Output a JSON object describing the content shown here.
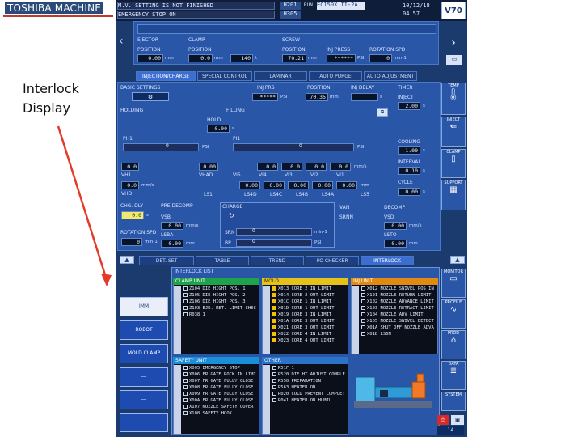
{
  "slide": {
    "brand": "TOSHIBA MACHINE",
    "caption_line1": "Interlock",
    "caption_line2": "Display"
  },
  "topbar": {
    "msg1": "M.V. SETTING IS NOT FINISHED",
    "msg2": "EMERGENCY STOP ON",
    "code1": "H201",
    "code2": "H305",
    "run": "RUN",
    "model": "EC150X II-2A",
    "date": "10/12/18",
    "time": "04:57",
    "logo": "V70"
  },
  "mold": {
    "headers": [
      "EJECTOR",
      "CLAMP",
      "SCREW"
    ],
    "fields": [
      {
        "label": "POSITION",
        "value": "0.00",
        "unit": "mm"
      },
      {
        "label": "POSITION",
        "value": "0.0",
        "unit": "mm"
      },
      {
        "label": "",
        "value": "140",
        "unit": "t"
      },
      {
        "label": "POSITION",
        "value": "70.21",
        "unit": "mm"
      },
      {
        "label": "INJ PRESS",
        "value": "******",
        "unit": "PSI"
      },
      {
        "label": "ROTATION SPD",
        "value": "0",
        "unit": "min-1"
      }
    ]
  },
  "tabs_upper": [
    "INJECTION/CHARGE",
    "SPECIAL CONTROL",
    "LAMINAR",
    "AUTO PURGE",
    "AUTO ADJUSTMENT"
  ],
  "injection": {
    "basic_settings": "BASIC SETTINGS",
    "inj_prs": "INJ PRS",
    "inj_prs_value": "*****",
    "inj_prs_unit": "PSI",
    "position": "POSITION",
    "position_value": "70.35",
    "position_unit": "mm",
    "inj_delay": "INJ DELAY",
    "inj_delay_unit": "s",
    "holding": "HOLDING",
    "filling": "FILLING",
    "hold": "HOLD",
    "hold_value": "0.00",
    "hold_unit": "s",
    "timer": "TIMER",
    "inject": "INJECT",
    "inject_value": "2.00",
    "inject_unit": "s",
    "cooling": "COOLING",
    "cooling_value": "1.00",
    "cooling_unit": "s",
    "interval": "INTERVAL",
    "interval_value": "0.10",
    "interval_unit": "s",
    "cycle": "CYCLE",
    "cycle_value": "0.00",
    "cycle_unit": "s",
    "ph": "PH1",
    "ph_value": "0",
    "ph_unit": "PSI",
    "pi": "PI1",
    "pi_value": "0",
    "pi_unit": "PSI",
    "vh_value": "0.0",
    "vhad": "VHAD",
    "vhad_value": "0.00",
    "vh1": "VH1",
    "vi_labels": [
      "VI5",
      "VI4",
      "VI3",
      "VI2",
      "VI1"
    ],
    "vi_values": [
      "0.0",
      "0.0",
      "0.0",
      "0.0"
    ],
    "vi_unit": "mm/s",
    "vhd": "VHD",
    "vhd_value": "0.0",
    "vhd_unit": "mm/s",
    "ls_labels": [
      "LS1",
      "LS4D",
      "LS4C",
      "LS4B",
      "LS4A",
      "LS5"
    ],
    "ls_values": [
      "0.00",
      "0.00",
      "0.00",
      "0.00",
      "0.00"
    ],
    "ls_unit": "mm"
  },
  "charge": {
    "chg_dly": "CHG. DLY",
    "chg_dly_value": "0.0",
    "chg_dly_unit": "s",
    "pre_decomp": "PRE DECOMP",
    "vsb": "VSB",
    "vsb_value": "0.00",
    "vsb_unit": "mm/s",
    "rotation_spd": "ROTATION SPD",
    "rotation_spd_value": "0",
    "rotation_spd_unit": "min-1",
    "lsba": "LSBA",
    "lsba_value": "0.00",
    "lsba_unit": "mm",
    "charge_label": "CHARGE",
    "srn": "SRN",
    "srn_value": "0",
    "srn_unit": "min-1",
    "bp": "BP",
    "bp_value": "0",
    "bp_unit": "PSI",
    "van": "VAN",
    "srnn": "SRNN",
    "decomp": "DECOMP",
    "vsd": "VSD",
    "vsd_value": "0.00",
    "vsd_unit": "mm/s",
    "lsto": "LSTO",
    "lsto_value": "0.00",
    "lsto_unit": "mm"
  },
  "tabs_lower": [
    "DET. SET",
    "TABLE",
    "TREND",
    "I/O CHECKER",
    "INTERLOCK"
  ],
  "interlock": {
    "title": "INTERLOCK LIST",
    "clamp_unit": {
      "header": "CLAMP UNIT",
      "rows": [
        "Z104 DIE HIGHT POS. 1",
        "Z105 DIE HIGHT POS. 2",
        "Z106 DIE HIGHT POS. 3",
        "Z103 EJE. RET. LIMIT CHEC",
        "R038 1"
      ]
    },
    "mold": {
      "header": "MOLD",
      "rows": [
        "X013 CORE 2 IN LIMIT",
        "X014 CORE 2 OUT LIMIT",
        "X01C CORE 1 IN LIMIT",
        "X01D CORE 1 OUT LIMIT",
        "X019 CORE 3 IN LIMIT",
        "X01A CORE 3 OUT LIMIT",
        "X021 CORE 3 OUT LIMIT",
        "X022 CORE 4 IN LIMIT",
        "X023 CORE 4 OUT LIMIT"
      ]
    },
    "inj_unit": {
      "header": "INJ UNIT",
      "rows": [
        "X012 NOZZLE SWIVEL POS IN",
        "X101 NOZZLE RETURN LIMIT",
        "X102 NOZZLE ADVANCE LIMIT",
        "X103 NOZZLE RETRACT LIMIT",
        "X104 NOZZLE ADV LIMIT",
        "X105 NOZZLE SWIVEL DETECT",
        "X01A SHUT OFF NOZZLE ADVA",
        "X01B LS6N"
      ]
    },
    "safety_unit": {
      "header": "SAFETY UNIT",
      "rows": [
        "X005 EMERGENCY STOP",
        "X006 FR GATE ROCK IN LIMI",
        "X007 FR GATE FULLY CLOSE",
        "X008 FR GATE FULLY CLOSE",
        "X009 FR GATE FULLY CLOSE",
        "X00A FR GATE FULLY CLOSE",
        "X107 NOZZLE SAFETY COVER",
        "X108 SAFETY HOOK"
      ]
    },
    "other": {
      "header": "OTHER",
      "rows": [
        "R51F 1",
        "R520 DIE HT ADJUST COMPLE",
        "R550 PREPARATION",
        "R563 HEATER ON",
        "R020 COLD PREVENT COMPLET",
        "R041 HEATER ON HUMIL"
      ]
    }
  },
  "left_buttons": [
    "IMM",
    "ROBOT",
    "MOLD CLAMP",
    "---",
    "---",
    "---",
    "---"
  ],
  "sidebar": [
    "TEMP",
    "INJECT",
    "CLAMP",
    "SUPPORT",
    "MONITOR",
    "PROFILE",
    "PROD",
    "DATA",
    "SYSTEM"
  ],
  "status": {
    "page": "14"
  },
  "colors": {
    "screen_bg": "#1b3a6e",
    "panel": "#2a56a8",
    "clamp_green": "#1fa34a",
    "mold_yellow": "#e5c21a",
    "inj_orange": "#e08a12",
    "safety_blue": "#1a8fd8",
    "arrow": "#e23b2a"
  }
}
